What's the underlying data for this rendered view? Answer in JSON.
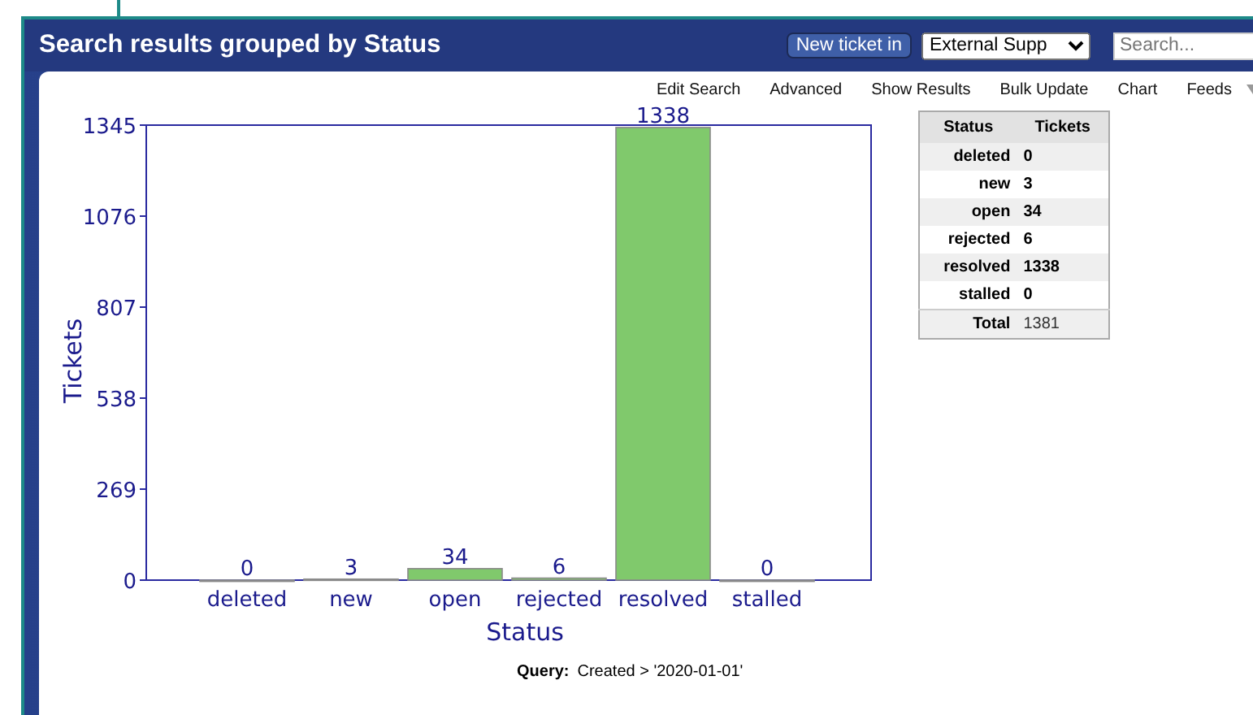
{
  "header": {
    "title": "Search results grouped by Status",
    "new_ticket_button": "New ticket in",
    "queue_select": "External Supp",
    "search": {
      "placeholder": "Search..."
    }
  },
  "menu": [
    "Edit Search",
    "Advanced",
    "Show Results",
    "Bulk Update",
    "Chart",
    "Feeds"
  ],
  "chart": {
    "chart_data": {
      "type": "bar",
      "xlabel": "Status",
      "ylabel": "Tickets",
      "categories": [
        "deleted",
        "new",
        "open",
        "rejected",
        "resolved",
        "stalled"
      ],
      "series": [
        {
          "color": "#80c96c",
          "values": [
            0,
            3,
            34,
            6,
            1338,
            0
          ]
        }
      ],
      "ylim": [
        0,
        1345
      ],
      "yticks": [
        0,
        269,
        538,
        807,
        1076,
        1345
      ],
      "data_labels": true
    }
  },
  "summary_table": {
    "columns": [
      "Status",
      "Tickets"
    ],
    "rows": [
      {
        "status": "deleted",
        "tickets": "0"
      },
      {
        "status": "new",
        "tickets": "3"
      },
      {
        "status": "open",
        "tickets": "34"
      },
      {
        "status": "rejected",
        "tickets": "6"
      },
      {
        "status": "resolved",
        "tickets": "1338"
      },
      {
        "status": "stalled",
        "tickets": "0"
      }
    ],
    "total": {
      "label": "Total",
      "value": "1381"
    }
  },
  "query": {
    "label": "Query:",
    "value": "Created > '2020-01-01'"
  }
}
